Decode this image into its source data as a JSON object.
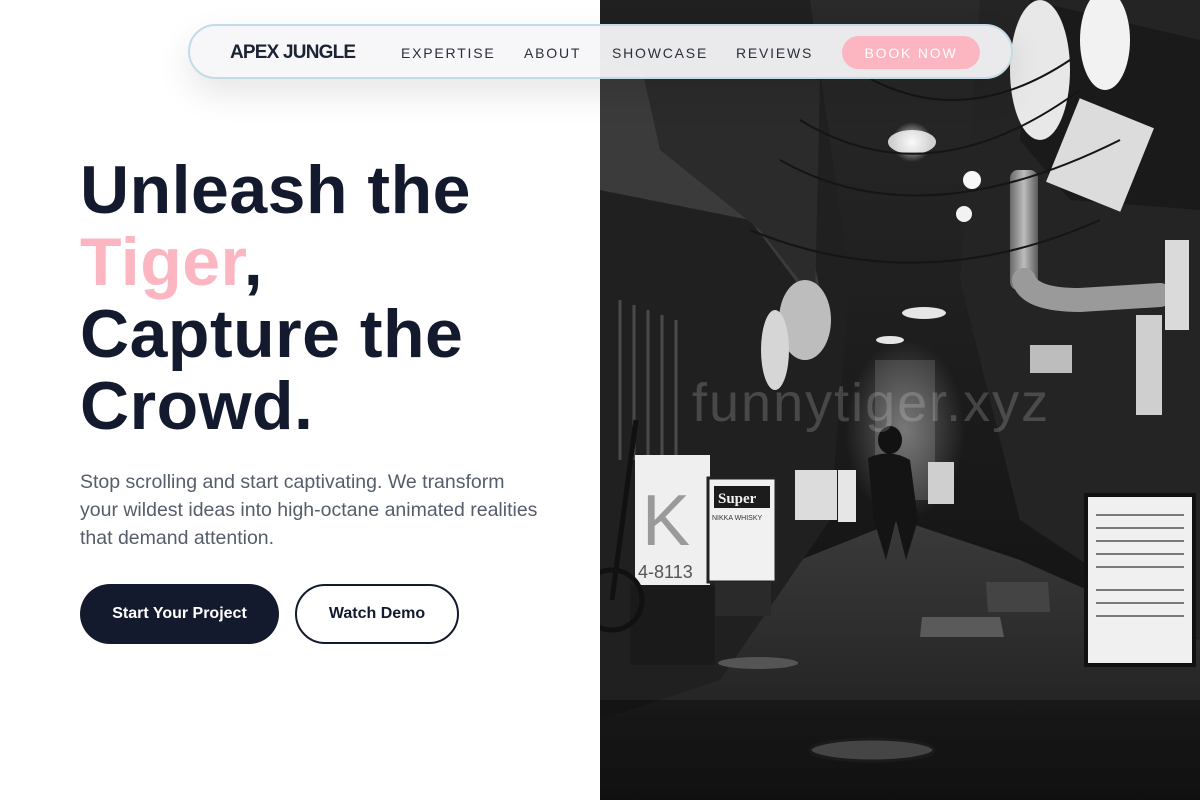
{
  "nav": {
    "brand": "APEX JUNGLE",
    "links": [
      "EXPERTISE",
      "ABOUT",
      "SHOWCASE",
      "REVIEWS"
    ],
    "cta": "BOOK NOW"
  },
  "hero": {
    "headline_line1": "Unleash the",
    "headline_accent": "Tiger",
    "headline_comma": ",",
    "headline_line3": "Capture the",
    "headline_line4": "Crowd.",
    "subtext": "Stop scrolling and start captivating. We transform your wildest ideas into high-octane animated realities that demand attention.",
    "primary_button": "Start Your Project",
    "secondary_button": "Watch Demo"
  },
  "photo": {
    "watermark": "funnytiger.xyz",
    "signs": {
      "super": "Super",
      "super_sub": "NIKKA WHISKY",
      "phone": "4-8113",
      "k_letter": "K"
    }
  },
  "colors": {
    "accent": "#fbb6c1",
    "dark": "#141a2e",
    "nav_border": "#c3dbe6"
  }
}
